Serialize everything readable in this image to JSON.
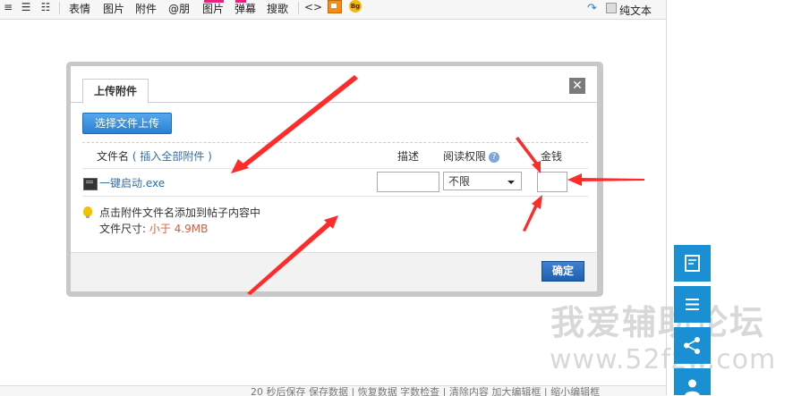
{
  "toolbar": {
    "items": [
      "表情",
      "图片",
      "附件",
      "@朋",
      "图片",
      "弹幕",
      "搜歌"
    ],
    "code_label": "<>",
    "bg_label": "Bg",
    "plain_text_label": "纯文本"
  },
  "dialog": {
    "tab_label": "上传附件",
    "close_label": "✕",
    "upload_button": "选择文件上传",
    "columns": {
      "filename": "文件名",
      "insert_all": "( 插入全部附件 )",
      "description": "描述",
      "permission": "阅读权限",
      "price": "金钱"
    },
    "file": {
      "name": "一键启动.exe",
      "permission": "不限"
    },
    "tip": "点击附件文件名添加到帖子内容中",
    "size_label": "文件尺寸:",
    "size_value": "小于 4.9MB",
    "ok_button": "确定"
  },
  "watermark": {
    "cn": "我爱辅助论坛",
    "en": "www.52fzw.com"
  },
  "status_bar": "20 秒后保存  保存数据 | 恢复数据    字数检查 | 清除内容    加大编辑框 | 缩小编辑框",
  "colors": {
    "accent": "#1a8fd4",
    "arrow": "#ff2a2a",
    "size_red": "#e05a3a"
  }
}
